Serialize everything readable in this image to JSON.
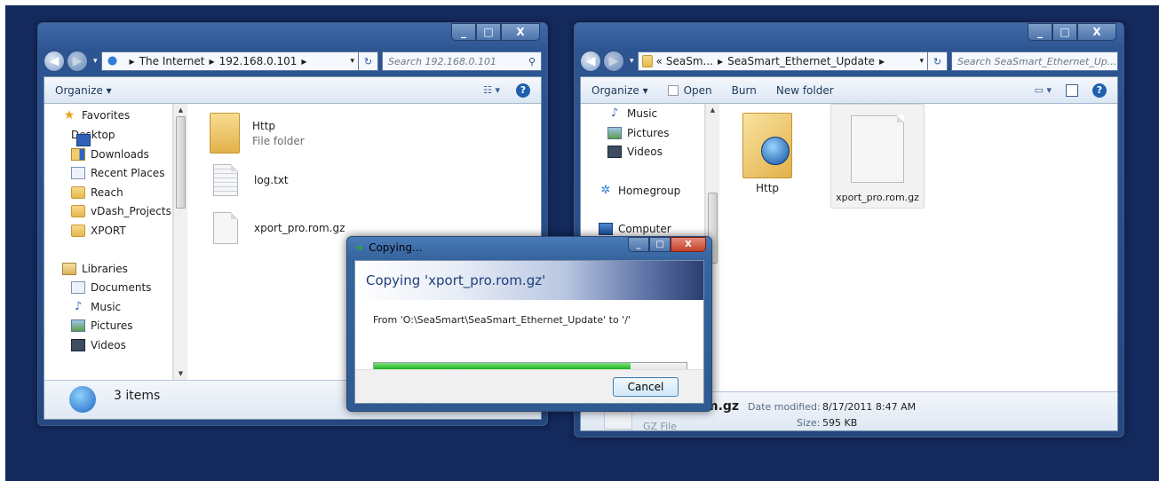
{
  "left_window": {
    "address": [
      "The Internet",
      "192.168.0.101"
    ],
    "search_placeholder": "Search 192.168.0.101",
    "toolbar": {
      "organize": "Organize ▾"
    },
    "nav_items": [
      {
        "label": "Favorites",
        "icon": "star-icon"
      },
      {
        "label": "Desktop",
        "icon": "desktop-icon"
      },
      {
        "label": "Downloads",
        "icon": "downloads-icon"
      },
      {
        "label": "Recent Places",
        "icon": "recent-places-icon"
      },
      {
        "label": "Reach",
        "icon": "folder-icon"
      },
      {
        "label": "vDash_Projects",
        "icon": "folder-icon"
      },
      {
        "label": "XPORT",
        "icon": "folder-icon"
      },
      {
        "label": "Libraries",
        "icon": "library-icon"
      },
      {
        "label": "Documents",
        "icon": "documents-icon"
      },
      {
        "label": "Music",
        "icon": "music-icon"
      },
      {
        "label": "Pictures",
        "icon": "pictures-icon"
      },
      {
        "label": "Videos",
        "icon": "videos-icon"
      }
    ],
    "files": [
      {
        "name": "Http",
        "type": "File folder"
      },
      {
        "name": "log.txt",
        "type": ""
      },
      {
        "name": "xport_pro.rom.gz",
        "type": ""
      }
    ],
    "status": "3 items"
  },
  "right_window": {
    "address": [
      "«",
      "SeaSm...",
      "SeaSmart_Ethernet_Update"
    ],
    "search_placeholder": "Search SeaSmart_Ethernet_Up...",
    "toolbar": {
      "organize": "Organize ▾",
      "open": "Open",
      "burn": "Burn",
      "new_folder": "New folder"
    },
    "nav_items": [
      {
        "label": "Music",
        "icon": "music-icon"
      },
      {
        "label": "Pictures",
        "icon": "pictures-icon"
      },
      {
        "label": "Videos",
        "icon": "videos-icon"
      },
      {
        "label": "Homegroup",
        "icon": "homegroup-icon"
      },
      {
        "label": "Computer",
        "icon": "computer-icon"
      }
    ],
    "files": [
      {
        "name": "Http"
      },
      {
        "name": "xport_pro.rom.gz"
      }
    ],
    "details": {
      "name_partial": "m.gz",
      "date_label": "Date modified:",
      "date_value": "8/17/2011 8:47 AM",
      "size_label": "Size:",
      "size_value": "595 KB",
      "type_partial": "GZ File"
    }
  },
  "dialog": {
    "title": "Copying...",
    "heading": "Copying 'xport_pro.rom.gz'",
    "from_text": "From 'O:\\SeaSmart\\SeaSmart_Ethernet_Update' to '/'",
    "progress_fraction": 0.82,
    "cancel_label": "Cancel"
  }
}
